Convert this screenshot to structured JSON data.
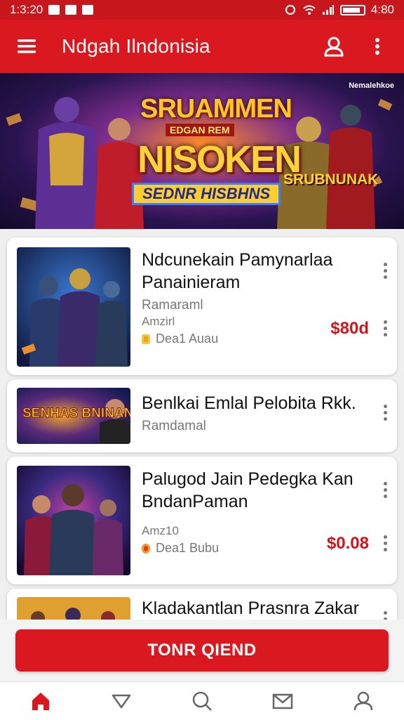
{
  "status_bar": {
    "time": "1:3:20",
    "clock": "4:80"
  },
  "app_bar": {
    "title": "Ndgah Ilndonisia"
  },
  "banner": {
    "watermark": "Nemalehkoe",
    "line1": "SRUAMMEN",
    "line2": "EDGAN REM",
    "line3": "NISOKEN",
    "line4": "SEDNR HISBHNS",
    "line5": "SRUBNUNAK"
  },
  "cards": [
    {
      "title": "Ndcunekain Pamynarlaa Panainieram",
      "sub": "Ramaraml",
      "meta_label": "Amzirl",
      "tag_text": "Dea1 Auau",
      "price": "$80d"
    },
    {
      "title": "Benlkai Emlal Pelobita Rkk.",
      "sub": "Ramdamal",
      "thumb_text": "SENHAS BNINAN"
    },
    {
      "title": "Palugod Jain Pedegka Kan BndanPaman",
      "meta_label": "Amz10",
      "tag_text": "Dea1 Bubu",
      "price": "$0.08"
    },
    {
      "title": "Kladakantlan Prasnra Zakar"
    }
  ],
  "cta": {
    "label": "TONR QIEND"
  },
  "colors": {
    "primary": "#d9191f",
    "price": "#d0161d"
  },
  "bottom_nav": [
    {
      "icon": "home-icon"
    },
    {
      "icon": "tag-icon"
    },
    {
      "icon": "search-icon"
    },
    {
      "icon": "mail-icon"
    },
    {
      "icon": "profile-icon"
    }
  ]
}
